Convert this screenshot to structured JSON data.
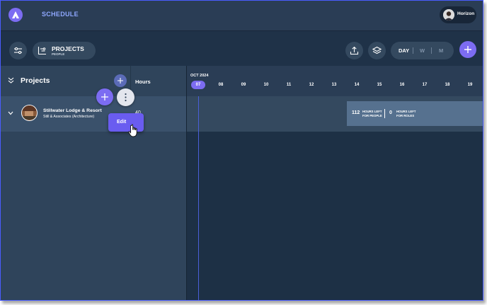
{
  "app": {
    "title": "SCHEDULE"
  },
  "user": {
    "name": "Horizon"
  },
  "toolbar": {
    "view_title": "PROJECTS",
    "view_subtitle": "PEOPLE",
    "range_options": [
      "DAY",
      "W",
      "M"
    ],
    "range_selected": "DAY"
  },
  "panel": {
    "title": "Projects",
    "hours_header": "Hours"
  },
  "project": {
    "name": "Stillwater Lodge & Resort",
    "client": "Still & Associates (Architecture)",
    "hours": "40"
  },
  "menu": {
    "items": [
      "Edit"
    ]
  },
  "timeline": {
    "month": "OCT 2024",
    "days": [
      "07",
      "08",
      "09",
      "10",
      "11",
      "12",
      "13",
      "14",
      "15",
      "16",
      "17",
      "18",
      "19"
    ],
    "today": "07"
  },
  "capacity": {
    "people_hours": "112",
    "people_label": [
      "HOURS LEFT",
      "FOR PEOPLE"
    ],
    "roles_hours": "0",
    "roles_label": [
      "HOURS LEFT",
      "FOR ROLES"
    ]
  },
  "colors": {
    "accent": "#7c6cf2",
    "background": "#1f3248",
    "panel": "#2f445b"
  },
  "icons": [
    "logo-icon",
    "filter-icon",
    "projects-view-icon",
    "upload-icon",
    "layers-icon",
    "plus-icon",
    "chevrons-collapse-icon",
    "chevron-down-icon",
    "more-vertical-icon",
    "hand-cursor-icon"
  ]
}
